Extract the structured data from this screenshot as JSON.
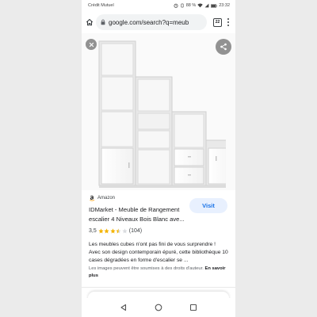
{
  "status_bar": {
    "carrier": "Crédit Mutuel",
    "battery": "88 %",
    "time": "23:32"
  },
  "browser": {
    "url": "google.com/search?q=meub",
    "tab_count": "22"
  },
  "icons": {
    "home": "home-icon",
    "lock": "lock-icon",
    "tabs": "tabs-icon",
    "menu": "more-vert-icon",
    "close": "close-icon",
    "share": "share-icon",
    "source": "amazon-logo",
    "back": "back-triangle-icon",
    "home_nav": "home-circle-icon",
    "recents": "recents-square-icon"
  },
  "product": {
    "source": "Amazon",
    "visit_label": "Visit",
    "title": "IDMarket - Meuble de Rangement escalier 4 Niveaux Bois Blanc ave...",
    "rating_value": "3,5",
    "rating_fraction": 0.7,
    "review_count": "(104)",
    "description": "Les meubles cubes n'ont pas fini de vous surprendre ! Avec son design contemporain épuré, cette bibliothèque 10 cases dégradées en forme d'escalier se ...",
    "copyright_note": "Les images peuvent être soumises à des droits d'auteur.",
    "learn_more": "En savoir plus"
  },
  "colors": {
    "accent": "#1a73e8",
    "visit_bg": "#e8f0fe",
    "star": "#f4b400"
  }
}
